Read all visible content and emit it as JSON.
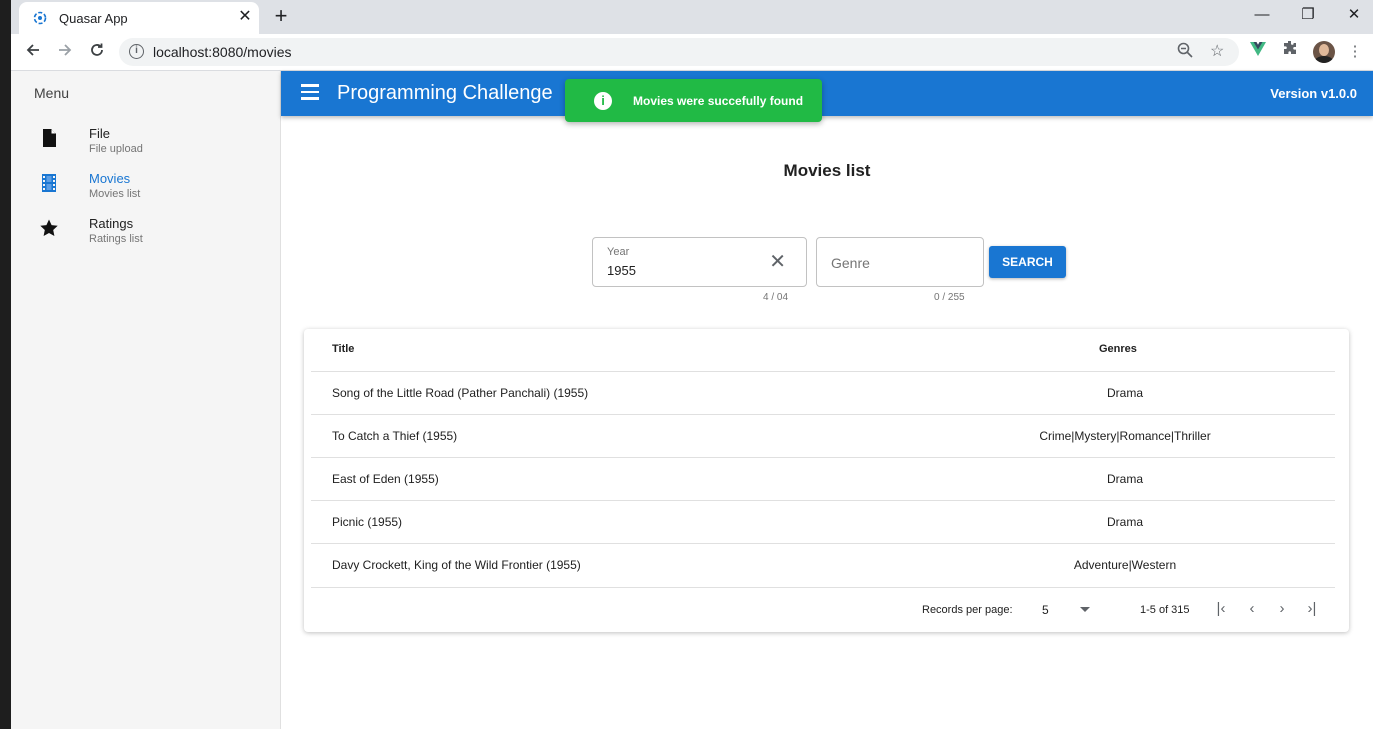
{
  "browser": {
    "tab_title": "Quasar App",
    "tab_close": "✕",
    "new_tab": "+",
    "url": "localhost:8080/movies",
    "window_controls": {
      "minimize": "—",
      "restore": "❐",
      "close": "✕"
    }
  },
  "drawer": {
    "header": "Menu",
    "items": [
      {
        "label": "File",
        "caption": "File upload",
        "icon": "file-icon"
      },
      {
        "label": "Movies",
        "caption": "Movies list",
        "icon": "film-icon",
        "active": true
      },
      {
        "label": "Ratings",
        "caption": "Ratings list",
        "icon": "star-icon"
      }
    ]
  },
  "header": {
    "title": "Programming Challenge",
    "version": "Version v1.0.0",
    "color": "#1976d2"
  },
  "notification": {
    "message": "Movies were succefully found",
    "color": "#21ba45"
  },
  "page": {
    "title": "Movies list"
  },
  "search": {
    "year": {
      "label": "Year",
      "value": "1955",
      "counter": "4 / 04"
    },
    "genre": {
      "placeholder": "Genre",
      "counter": "0 / 255"
    },
    "button_label": "SEARCH"
  },
  "table": {
    "columns": [
      "Title",
      "Genres"
    ],
    "rows": [
      {
        "title": "Song of the Little Road (Pather Panchali) (1955)",
        "genres": "Drama"
      },
      {
        "title": "To Catch a Thief (1955)",
        "genres": "Crime|Mystery|Romance|Thriller"
      },
      {
        "title": "East of Eden (1955)",
        "genres": "Drama"
      },
      {
        "title": "Picnic (1955)",
        "genres": "Drama"
      },
      {
        "title": "Davy Crockett, King of the Wild Frontier (1955)",
        "genres": "Adventure|Western"
      }
    ],
    "footer": {
      "records_per_page_label": "Records per page:",
      "records_per_page_value": "5",
      "range": "1-5 of 315",
      "first": "|‹",
      "prev": "‹",
      "next": "›",
      "last": "›|"
    }
  }
}
